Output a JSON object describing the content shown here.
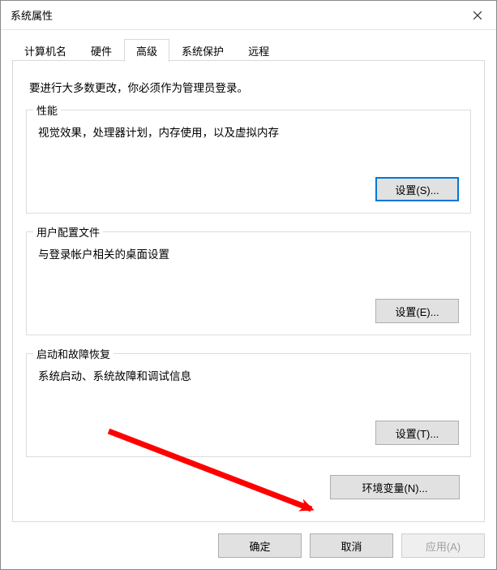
{
  "window": {
    "title": "系统属性"
  },
  "tabs": {
    "computer_name": "计算机名",
    "hardware": "硬件",
    "advanced": "高级",
    "system_protection": "系统保护",
    "remote": "远程"
  },
  "intro": "要进行大多数更改，你必须作为管理员登录。",
  "groups": {
    "performance": {
      "legend": "性能",
      "desc": "视觉效果，处理器计划，内存使用，以及虚拟内存",
      "button": "设置(S)..."
    },
    "user_profiles": {
      "legend": "用户配置文件",
      "desc": "与登录帐户相关的桌面设置",
      "button": "设置(E)..."
    },
    "startup_recovery": {
      "legend": "启动和故障恢复",
      "desc": "系统启动、系统故障和调试信息",
      "button": "设置(T)..."
    }
  },
  "env_button": "环境变量(N)...",
  "footer": {
    "ok": "确定",
    "cancel": "取消",
    "apply": "应用(A)"
  }
}
